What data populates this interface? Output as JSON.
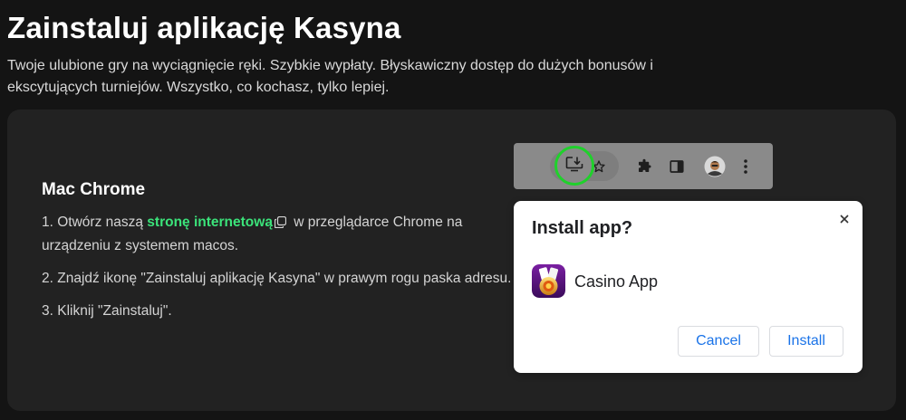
{
  "header": {
    "title": "Zainstaluj aplikację Kasyna",
    "subtitle": "Twoje ulubione gry na wyciągnięcie ręki. Szybkie wypłaty. Błyskawiczny dostęp do dużych bonusów i ekscytujących turniejów. Wszystko, co kochasz, tylko lepiej."
  },
  "instructions": {
    "title": "Mac Chrome",
    "step1_before": "1. Otwórz naszą ",
    "step1_link": "stronę internetową",
    "step1_after": " w przeglądarce Chrome na urządzeniu z systemem macos.",
    "step2": "2. Znajdź ikonę \"Zainstaluj aplikację Kasyna\" w prawym rogu paska adresu.",
    "step3": "3. Kliknij \"Zainstaluj\"."
  },
  "toolbar": {
    "icons": [
      "install-app-icon",
      "star-icon",
      "extensions-puzzle-icon",
      "side-panel-icon",
      "profile-avatar",
      "more-vert-icon"
    ]
  },
  "dialog": {
    "title": "Install app?",
    "app_name": "Casino App",
    "cancel_label": "Cancel",
    "install_label": "Install"
  },
  "colors": {
    "background": "#141414",
    "card": "#222222",
    "link": "#3be37a",
    "highlight": "#1fd12b",
    "dialog_button_text": "#1a73e8"
  }
}
